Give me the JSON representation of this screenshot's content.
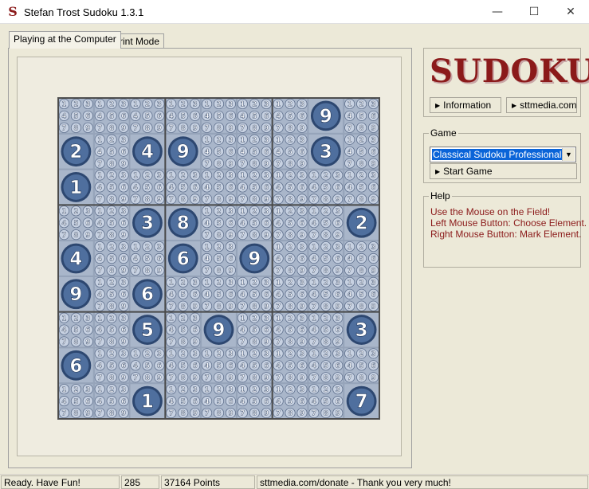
{
  "window": {
    "title": "Stefan Trost Sudoku 1.3.1",
    "app_icon_glyph": "S",
    "minimize": "—",
    "maximize": "☐",
    "close": "✕"
  },
  "tabs": [
    {
      "label": "Playing at the Computer",
      "active": true
    },
    {
      "label": "Print Mode",
      "active": false
    }
  ],
  "logo": {
    "text": "SUDOKU",
    "color": "#8b1a1a"
  },
  "links": {
    "information": "Information",
    "sttmedia": "sttmedia.com"
  },
  "game": {
    "legend": "Game",
    "selected": "Classical Sudoku Professional",
    "start_button": "Start Game"
  },
  "help": {
    "legend": "Help",
    "lines": [
      "Use the Mouse on the Field!",
      "Left Mouse Button: Choose Element.",
      "Right Mouse Button: Mark Element."
    ]
  },
  "board": {
    "givens": [
      [
        null,
        null,
        null,
        null,
        null,
        null,
        null,
        9,
        null
      ],
      [
        2,
        null,
        4,
        9,
        null,
        null,
        null,
        3,
        null
      ],
      [
        1,
        null,
        null,
        null,
        null,
        null,
        null,
        null,
        null
      ],
      [
        null,
        null,
        3,
        8,
        null,
        null,
        null,
        null,
        2
      ],
      [
        4,
        null,
        null,
        6,
        null,
        9,
        null,
        null,
        null
      ],
      [
        9,
        null,
        6,
        null,
        null,
        null,
        null,
        null,
        null
      ],
      [
        null,
        null,
        5,
        null,
        9,
        null,
        null,
        null,
        3
      ],
      [
        6,
        null,
        null,
        null,
        null,
        null,
        null,
        null,
        null
      ],
      [
        null,
        null,
        1,
        null,
        null,
        null,
        null,
        null,
        7
      ]
    ],
    "candidates": [
      1,
      2,
      3,
      4,
      5,
      6,
      7,
      8,
      9
    ],
    "colors": {
      "given_fill": "#4f6f9e",
      "given_text": "#ffffff",
      "candidate_fill": "#c8d2e2",
      "cell_bg": "#a9b6ca"
    }
  },
  "status": {
    "message": "Ready. Have Fun!",
    "count": "285",
    "points": "37164 Points",
    "donate": "sttmedia.com/donate - Thank you very much!"
  }
}
